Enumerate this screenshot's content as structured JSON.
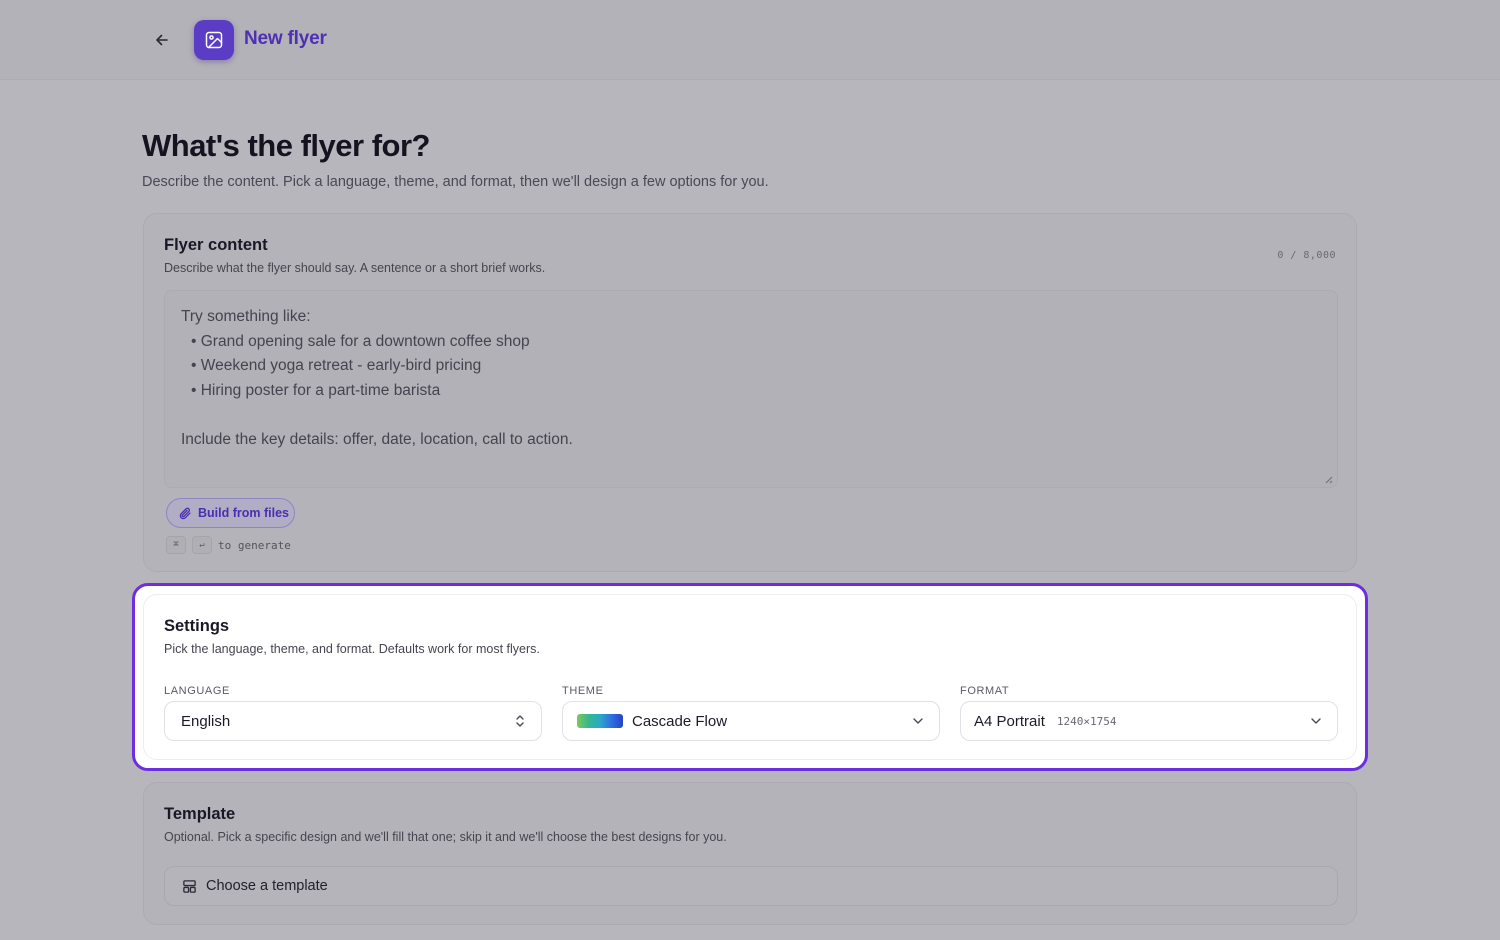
{
  "header": {
    "back_icon": "arrow-left-icon",
    "app_icon": "image-icon",
    "title": "New flyer"
  },
  "page": {
    "title": "What's the flyer for?",
    "subtitle": "Describe the content. Pick a language, theme, and format, then we'll design a few options for you."
  },
  "content_card": {
    "title": "Flyer content",
    "description": "Describe what the flyer should say. A sentence or a short brief works.",
    "char_count": "0 / 8,000",
    "placeholder": {
      "intro": "Try something like:",
      "examples": [
        "Grand opening sale for a downtown coffee shop",
        "Weekend yoga retreat - early-bird pricing",
        "Hiring poster for a part-time barista"
      ],
      "outro": "Include the key details: offer, date, location, call to action."
    },
    "value": "",
    "build_button": {
      "label": "Build from files",
      "icon": "paperclip-icon"
    },
    "shortcut": {
      "key1": "⌘",
      "key2": "↵",
      "label": "to generate"
    }
  },
  "settings_card": {
    "title": "Settings",
    "description": "Pick the language, theme, and format. Defaults work for most flyers.",
    "language": {
      "label": "LANGUAGE",
      "value": "English",
      "icon": "chevron-up-down-icon"
    },
    "theme": {
      "label": "THEME",
      "value": "Cascade Flow",
      "swatch_colors": [
        "#7ec85a",
        "#35b88e",
        "#2aa8c9",
        "#2f6fe0",
        "#2342c8"
      ],
      "icon": "chevron-down-icon"
    },
    "format": {
      "label": "FORMAT",
      "value": "A4 Portrait",
      "dimensions": "1240×1754",
      "icon": "chevron-down-icon"
    },
    "highlight_color": "#6d2ee0"
  },
  "template_card": {
    "title": "Template",
    "description": "Optional. Pick a specific design and we'll fill that one; skip it and we'll choose the best designs for you.",
    "button_label": "Choose a template",
    "button_icon": "layout-template-icon"
  },
  "colors": {
    "accent": "#5b3cc4",
    "accent_text": "#4f2fb3"
  }
}
